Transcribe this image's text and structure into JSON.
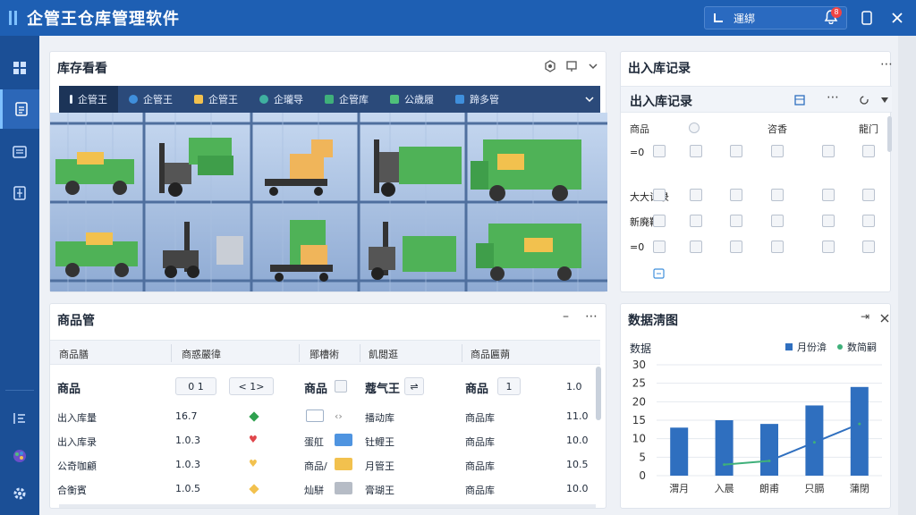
{
  "app": {
    "title": "企管王仓库管理软件"
  },
  "header": {
    "user_label": "運綁",
    "badge": "8"
  },
  "warehouse": {
    "title": "库存看看",
    "tabs": [
      {
        "label": "企管王",
        "color": "#e8f0ff"
      },
      {
        "label": "企管王",
        "color": "#3f8fdc"
      },
      {
        "label": "企管王",
        "color": "#f2c14e"
      },
      {
        "label": "企瓏导",
        "color": "#3fb0a0"
      },
      {
        "label": "企管库",
        "color": "#3fb07a"
      },
      {
        "label": "公歳履",
        "color": "#4fc07a"
      },
      {
        "label": "蹄多管",
        "color": "#3f8fdc"
      }
    ]
  },
  "io": {
    "title": "出入库记录",
    "sub_title": "出入库记录",
    "headers": [
      "商品",
      "咨香",
      "龍门"
    ],
    "rows": [
      "=0",
      "大大记录",
      "新廃鞴",
      "=0"
    ]
  },
  "goods": {
    "title": "商品管",
    "columns": [
      "商品膳",
      "商惑嚴徫",
      "鄮槽術",
      "飢閲逛",
      "商品匾蒴"
    ],
    "filter_row": {
      "label": "商品",
      "pager": "0  1",
      "nav": "<  1>",
      "label2": "商品",
      "label3": "蔻气王",
      "label4": "商品",
      "page": "1",
      "value": "1.0"
    },
    "rows": [
      {
        "name": "出入库量",
        "num": "16.7",
        "marker": "diamond",
        "marker_color": "#2fa14f",
        "type": "",
        "swatch": "outline",
        "owner": "播动库",
        "place": "商品库",
        "qty": "11.0"
      },
      {
        "name": "出入库录",
        "num": "1.0.3",
        "marker": "heart",
        "marker_color": "#e0464b",
        "type": "蛋舡",
        "swatch": "#4f94e0",
        "owner": "钍鲤王",
        "place": "商品库",
        "qty": "10.0"
      },
      {
        "name": "公奇咖顧",
        "num": "1.0.3",
        "marker": "heart",
        "marker_color": "#f2c14e",
        "type": "商品/",
        "swatch": "#f2c14e",
        "owner": "月管王",
        "place": "商品库",
        "qty": "10.5"
      },
      {
        "name": "合衡賓",
        "num": "1.0.5",
        "marker": "diamond",
        "marker_color": "#f2c14e",
        "type": "灿駢",
        "swatch": "#b6bcc6",
        "owner": "膏瑚王",
        "place": "商品库",
        "qty": "10.0"
      }
    ]
  },
  "stats": {
    "title": "数据淸图",
    "legend_title": "数据"
  },
  "chart_data": {
    "type": "bar",
    "categories": [
      "渭月",
      "入晨",
      "朗甫",
      "只膈",
      "蒲閉"
    ],
    "series": [
      {
        "name": "月份渰",
        "values": [
          13,
          15,
          14,
          19,
          24
        ],
        "color": "#2f6fbf"
      },
      {
        "name": "数简嗣",
        "values": [
          null,
          3,
          4,
          9,
          14
        ],
        "color": "#3fb07a"
      }
    ],
    "ylim": [
      0,
      30
    ],
    "yticks": [
      0,
      5,
      10,
      15,
      20,
      25,
      30
    ],
    "grid": true,
    "legend": "top-right"
  }
}
